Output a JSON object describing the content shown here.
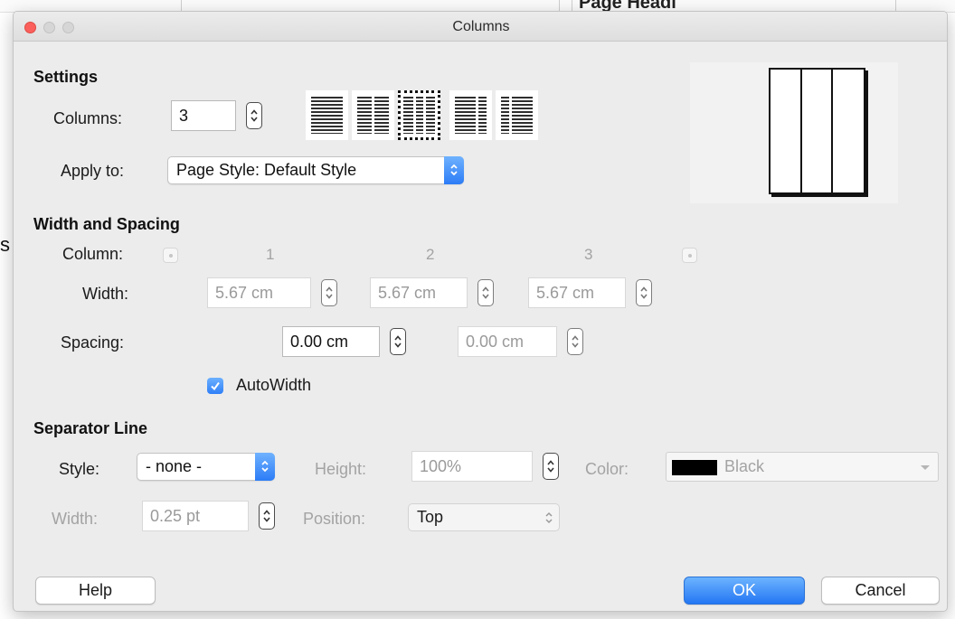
{
  "background": {
    "heading_fragment": "Page Headi",
    "left_fragment": "s"
  },
  "window": {
    "title": "Columns"
  },
  "settings": {
    "section_title": "Settings",
    "columns_label": "Columns:",
    "columns_value": "3",
    "apply_to_label": "Apply to:",
    "apply_to_value": "Page Style: Default Style",
    "selected_preset_index": 2,
    "preview_column_count": 3
  },
  "width_spacing": {
    "section_title": "Width and Spacing",
    "column_label": "Column:",
    "column_numbers": [
      "1",
      "2",
      "3"
    ],
    "width_label": "Width:",
    "widths": [
      "5.67 cm",
      "5.67 cm",
      "5.67 cm"
    ],
    "spacing_label": "Spacing:",
    "spacings": [
      "0.00 cm",
      "0.00 cm"
    ],
    "autowidth_label": "AutoWidth",
    "autowidth_checked": true
  },
  "separator": {
    "section_title": "Separator Line",
    "style_label": "Style:",
    "style_value": "- none -",
    "height_label": "Height:",
    "height_value": "100%",
    "color_label": "Color:",
    "color_value": "Black",
    "color_hex": "#000000",
    "width_label": "Width:",
    "width_value": "0.25 pt",
    "position_label": "Position:",
    "position_value": "Top"
  },
  "buttons": {
    "help": "Help",
    "ok": "OK",
    "cancel": "Cancel"
  },
  "colors": {
    "accent": "#2f7ff7",
    "dim_text": "#a3a3a3"
  }
}
